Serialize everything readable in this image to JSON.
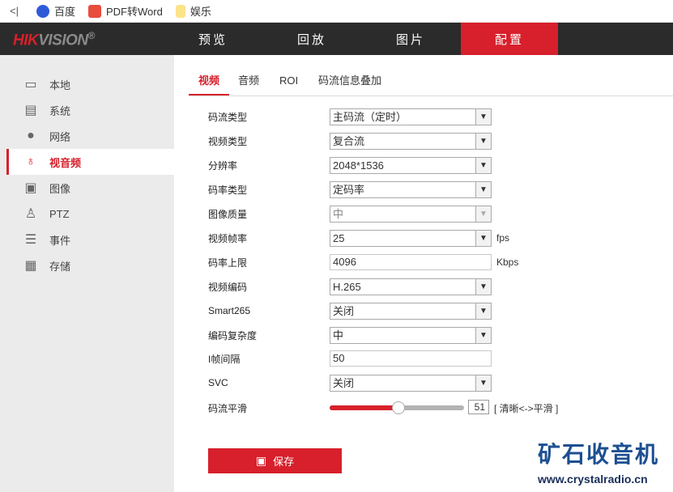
{
  "bookmarks": {
    "back": "<|",
    "items": [
      {
        "label": "百度",
        "icon": "baidu-icon"
      },
      {
        "label": "PDF转Word",
        "icon": "pdf-icon"
      },
      {
        "label": "娱乐",
        "icon": "folder-icon"
      }
    ]
  },
  "header": {
    "logo_red": "HIK",
    "logo_gray": "VISION",
    "logo_mark": "®",
    "nav": [
      "预览",
      "回放",
      "图片",
      "配置"
    ],
    "active_nav": "配置"
  },
  "sidebar": {
    "items": [
      {
        "label": "本地",
        "icon": "monitor-icon"
      },
      {
        "label": "系统",
        "icon": "window-icon"
      },
      {
        "label": "网络",
        "icon": "globe-icon"
      },
      {
        "label": "视音频",
        "icon": "mic-video-icon"
      },
      {
        "label": "图像",
        "icon": "image-icon"
      },
      {
        "label": "PTZ",
        "icon": "ptz-icon"
      },
      {
        "label": "事件",
        "icon": "calendar-icon"
      },
      {
        "label": "存储",
        "icon": "floppy-icon"
      }
    ],
    "active": "视音频"
  },
  "tabs": [
    "视频",
    "音频",
    "ROI",
    "码流信息叠加"
  ],
  "form": {
    "stream_type": {
      "label": "码流类型",
      "value": "主码流（定时）"
    },
    "video_type": {
      "label": "视频类型",
      "value": "复合流"
    },
    "resolution": {
      "label": "分辨率",
      "value": "2048*1536"
    },
    "bitrate_type": {
      "label": "码率类型",
      "value": "定码率"
    },
    "image_quality": {
      "label": "图像质量",
      "value": "中"
    },
    "frame_rate": {
      "label": "视频帧率",
      "value": "25",
      "unit": "fps"
    },
    "max_bitrate": {
      "label": "码率上限",
      "value": "4096",
      "unit": "Kbps"
    },
    "encoding": {
      "label": "视频编码",
      "value": "H.265"
    },
    "smart265": {
      "label": "Smart265",
      "value": "关闭"
    },
    "complexity": {
      "label": "编码复杂度",
      "value": "中"
    },
    "i_frame": {
      "label": "I帧间隔",
      "value": "50"
    },
    "svc": {
      "label": "SVC",
      "value": "关闭"
    },
    "smoothing": {
      "label": "码流平滑",
      "value": "51",
      "hint": "[ 清晰<->平滑 ]"
    }
  },
  "save_label": "保存",
  "watermark": {
    "title": "矿石收音机",
    "url": "www.crystalradio.cn"
  },
  "colors": {
    "accent": "#d7202b",
    "header": "#2b2b2b",
    "sidebar": "#ebebeb"
  }
}
